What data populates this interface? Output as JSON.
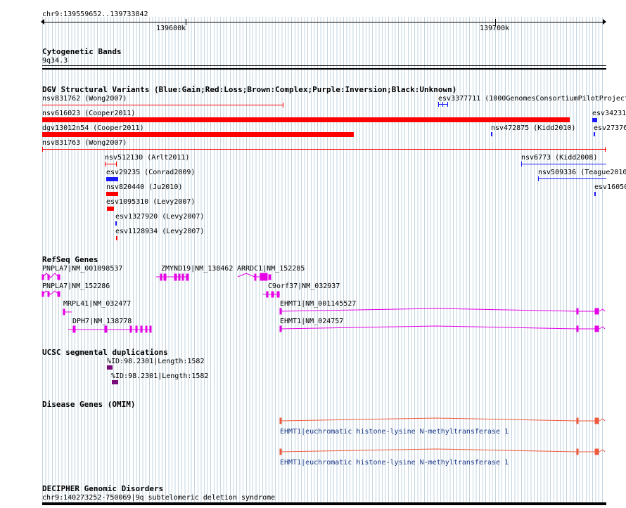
{
  "ruler": {
    "range_label": "chr9:139559652..139733842",
    "tick_labels": [
      "139600k",
      "139700k"
    ]
  },
  "cytoband": {
    "title": "Cytogenetic Bands",
    "band": "9q34.3"
  },
  "dgv": {
    "title": "DGV Structural Variants (Blue:Gain;Red:Loss;Brown:Complex;Purple:Inversion;Black:Unknown)",
    "colors": {
      "gain": "#1a1aff",
      "loss": "#ff0000"
    },
    "labels": {
      "nsv831762": "nsv831762 (Wong2007)",
      "nsv616023": "nsv616023 (Cooper2011)",
      "dgv13012n54": "dgv13012n54 (Cooper2011)",
      "nsv831763": "nsv831763 (Wong2007)",
      "nsv512130": "nsv512130 (Arlt2011)",
      "esv29235": "esv29235 (Conrad2009)",
      "nsv820440": "nsv820440 (Ju2010)",
      "esv1095310": "esv1095310 (Levy2007)",
      "esv1327920": "esv1327920 (Levy2007)",
      "esv1128934": "esv1128934 (Levy2007)",
      "esv3377711": "esv3377711 (1000GenomesConsortiumPilotProject",
      "nsv472875": "nsv472875 (Kidd2010)",
      "nsv6773": "nsv6773 (Kidd2008)",
      "nsv509336": "nsv509336 (Teague2010",
      "esv34231": "esv34231",
      "esv27376": "esv27376",
      "esv16050": "esv16050"
    }
  },
  "refseq": {
    "title": "RefSeq Genes",
    "color": "#e600e6",
    "genes": {
      "pnpla7_1": "PNPLA7|NM_001098537",
      "zmynd19": "ZMYND19|NM_138462",
      "arrdc1": "ARRDC1|NM_152285",
      "pnpla7_2": "PNPLA7|NM_152286",
      "c9orf37": "C9orf37|NM_032937",
      "mrpl41": "MRPL41|NM_032477",
      "ehmt1_1": "EHMT1|NM_001145527",
      "dph7": "DPH7|NM_138778",
      "ehmt1_2": "EHMT1|NM_024757"
    }
  },
  "segdup": {
    "title": "UCSC segmental duplications",
    "color": "#7a0a7a",
    "items": [
      "%ID:98.2301|Length:1582",
      "%ID:98.2301|Length:1582"
    ]
  },
  "omim": {
    "title": "Disease Genes (OMIM)",
    "color": "#f05a3c",
    "items": [
      "EHMT1|euchromatic histone-lysine N-methyltransferase 1",
      "EHMT1|euchromatic histone-lysine N-methyltransferase 1"
    ]
  },
  "decipher": {
    "title": "DECIPHER Genomic Disorders",
    "item": "chr9:140273252-750069|9q subtelomeric deletion syndrome"
  }
}
